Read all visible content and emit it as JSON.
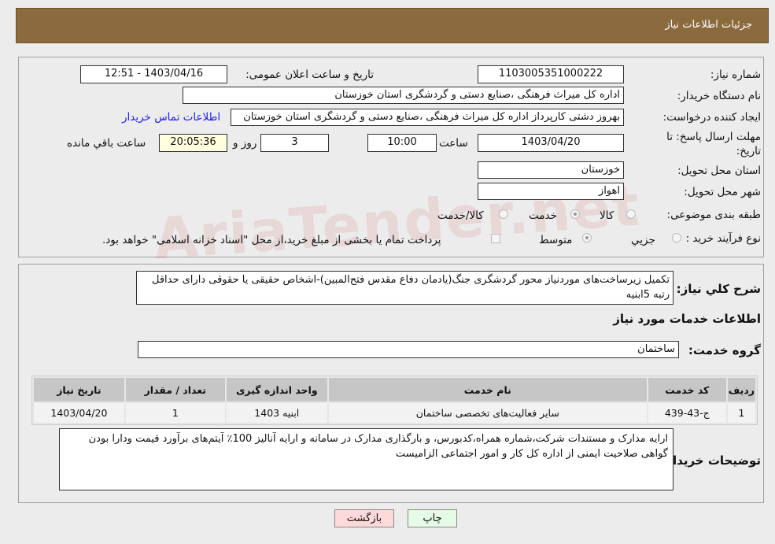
{
  "header": {
    "title": "جزئیات اطلاعات نیاز"
  },
  "watermark": "AriaTender.net",
  "form": {
    "need_number_label": "شماره نیاز:",
    "need_number": "1103005351000222",
    "announce_label": "تاریخ و ساعت اعلان عمومی:",
    "announce_value": "1403/04/16 - 12:51",
    "buyer_org_label": "نام دستگاه خریدار:",
    "buyer_org": "اداره کل میراث فرهنگی ،صنایع دستی و گردشگری استان خوزستان",
    "creator_label": "ایجاد کننده درخواست:",
    "creator": "بهروز دشتی کارپرداز اداره کل میراث فرهنگی ،صنایع دستی و گردشگری استان خوزستان",
    "contact_link": "اطلاعات تماس خریدار",
    "deadline_label": "مهلت ارسال پاسخ: تا",
    "deadline_label2": "تاریخ:",
    "deadline_date": "1403/04/20",
    "time_label": "ساعت",
    "deadline_time": "10:00",
    "days": "3",
    "days_label": "روز و",
    "remaining": "20:05:36",
    "remaining_label": "ساعت باقي مانده",
    "province_label": "استان محل تحویل:",
    "province": "خوزستان",
    "city_label": "شهر محل تحویل:",
    "city": "اهواز",
    "category_label": "طبقه بندی موضوعی:",
    "category_options": [
      "کالا",
      "خدمت",
      "کالا/خدمت"
    ],
    "category_selected": "خدمت",
    "process_label": "نوع فرآیند خرید :",
    "process_options": [
      "جزیي",
      "متوسط"
    ],
    "process_selected": "متوسط",
    "payment_note": "پرداخت تمام یا بخشی از مبلغ خرید،از محل \"اسناد خزانه اسلامی\" خواهد بود."
  },
  "details": {
    "desc_label": "شرح کلي نیاز:",
    "desc": "تکمیل زیرساخت‌های موردنیاز محور گردشگری جنگ(یادمان دفاع مقدس فتح‌المبین)-اشخاص حقیقی یا حقوقی دارای حداقل رتبه 5ابنیه",
    "services_title": "اطلاعات خدمات مورد نیاز",
    "group_label": "گروه خدمت:",
    "group": "ساختمان",
    "table": {
      "headers": [
        "ردیف",
        "کد خدمت",
        "نام خدمت",
        "واحد اندازه گیری",
        "تعداد / مقدار",
        "تاریخ نیاز"
      ],
      "rows": [
        [
          "1",
          "ج-43-439",
          "سایر فعالیت‌های تخصصی ساختمان",
          "ابنیه 1403",
          "1",
          "1403/04/20"
        ]
      ]
    },
    "notes_label": "توضیحات خریدار:",
    "notes": "ارایه مدارک و مستندات شرکت،شماره همراه،کدبورس، و بارگذاری مدارک در سامانه و ارایه آنالیز 100٪ آیتم‌های برآورد قیمت ودارا بودن گواهی صلاحیت ایمنی از اداره کل کار و امور اجتماعی الزامیست"
  },
  "buttons": {
    "back": "بازگشت",
    "print": "چاپ"
  }
}
